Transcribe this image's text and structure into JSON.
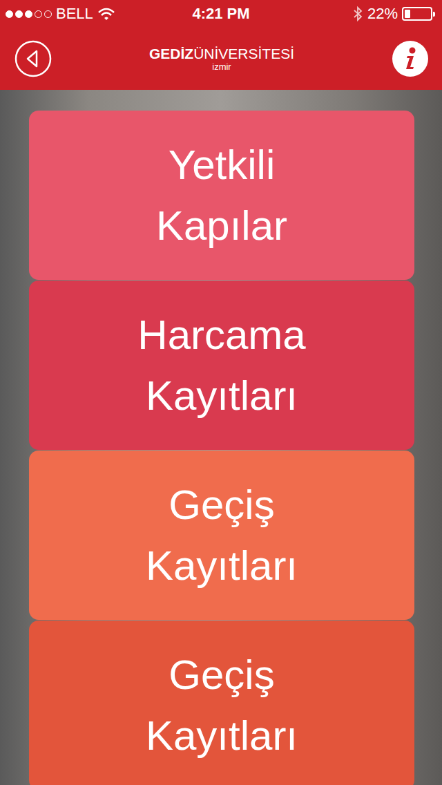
{
  "status_bar": {
    "signal": {
      "level": 0.6
    },
    "carrier": "BELL",
    "time": "4:21 PM",
    "battery": {
      "reading": "22%",
      "level": 0.22
    }
  },
  "nav": {
    "title_bold": "GEDİZ",
    "title_rest": "ÜNİVERSİTESİ",
    "subtitle": "izmir"
  },
  "menu": [
    {
      "lines": [
        "Yetkili",
        "Kapılar"
      ],
      "color": "#e8566a"
    },
    {
      "lines": [
        "Harcama",
        "Kayıtları"
      ],
      "color": "#d93a4f"
    },
    {
      "lines": [
        "Geçiş",
        "Kayıtları"
      ],
      "color": "#f06c4d"
    },
    {
      "lines": [
        "Geçiş",
        "Kayıtları"
      ],
      "color": "#e3553b"
    }
  ]
}
